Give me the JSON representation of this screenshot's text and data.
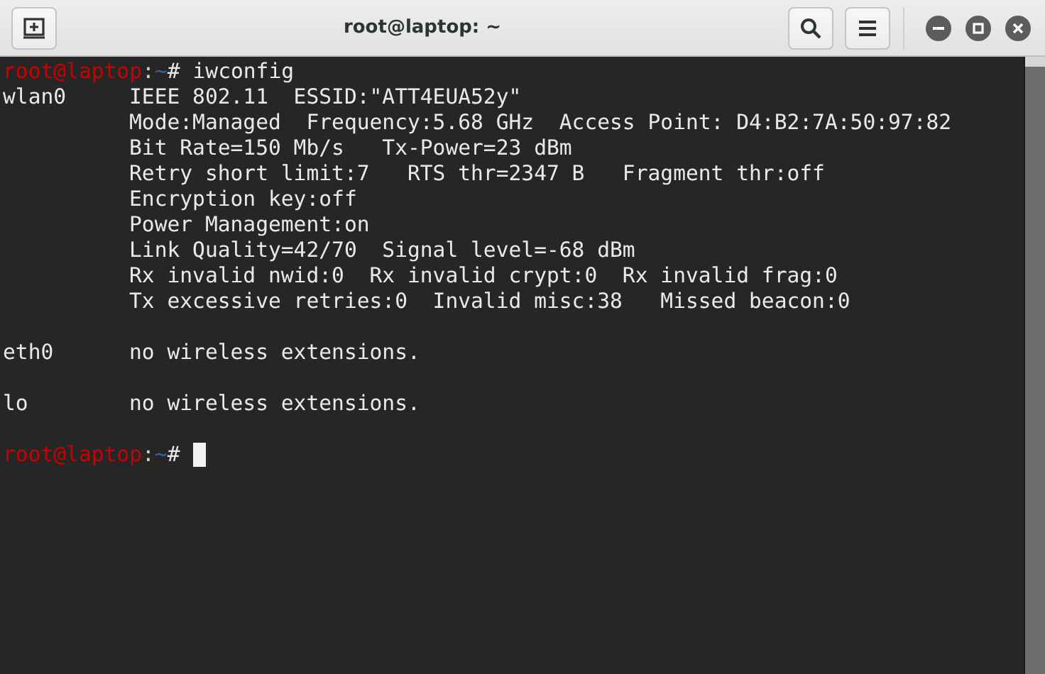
{
  "window": {
    "title": "root@laptop: ~"
  },
  "terminal": {
    "lines": [
      {
        "kind": "prompt",
        "user_host": "root@laptop",
        "separator": ":",
        "path": "~",
        "symbol": "#",
        "command": "iwconfig"
      },
      {
        "kind": "output",
        "interface": "wlan0",
        "text": "IEEE 802.11  ESSID:\"ATT4EUA52y\""
      },
      {
        "kind": "output",
        "text": "Mode:Managed  Frequency:5.68 GHz  Access Point: D4:B2:7A:50:97:82"
      },
      {
        "kind": "output",
        "text": "Bit Rate=150 Mb/s   Tx-Power=23 dBm"
      },
      {
        "kind": "output",
        "text": "Retry short limit:7   RTS thr=2347 B   Fragment thr:off"
      },
      {
        "kind": "output",
        "text": "Encryption key:off"
      },
      {
        "kind": "output",
        "text": "Power Management:on"
      },
      {
        "kind": "output",
        "text": "Link Quality=42/70  Signal level=-68 dBm"
      },
      {
        "kind": "output",
        "text": "Rx invalid nwid:0  Rx invalid crypt:0  Rx invalid frag:0"
      },
      {
        "kind": "output",
        "text": "Tx excessive retries:0  Invalid misc:38   Missed beacon:0"
      },
      {
        "kind": "blank"
      },
      {
        "kind": "output",
        "interface": "eth0",
        "text": "no wireless extensions."
      },
      {
        "kind": "blank"
      },
      {
        "kind": "output",
        "interface": "lo",
        "text": "no wireless extensions."
      },
      {
        "kind": "blank"
      },
      {
        "kind": "prompt",
        "user_host": "root@laptop",
        "separator": ":",
        "path": "~",
        "symbol": "#",
        "cursor": true
      }
    ]
  }
}
